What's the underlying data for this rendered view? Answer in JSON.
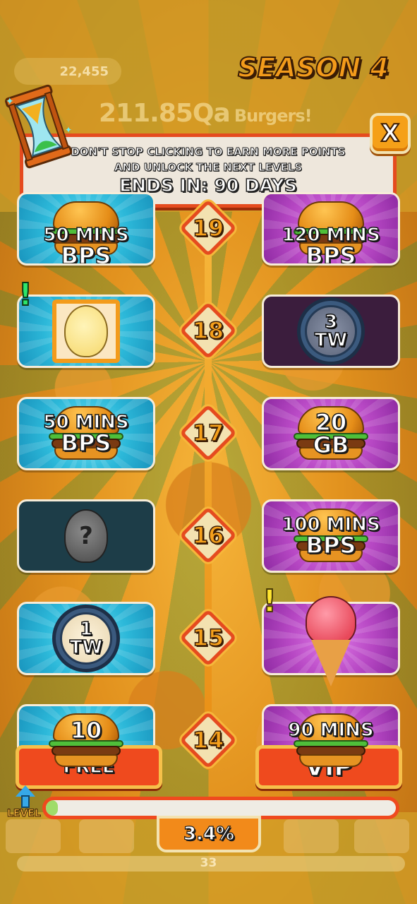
{
  "hud": {
    "score": "22,455",
    "burgers_amount": "211.85Qa",
    "burgers_unit": "Burgers!"
  },
  "season": {
    "title": "SEASON 4"
  },
  "banner": {
    "line1": "DON'T STOP CLICKING TO EARN MORE POINTS",
    "line2": "AND UNLOCK THE NEXT LEVELS",
    "ends": "ENDS IN: 90 DAYS",
    "close_label": "X"
  },
  "levels": [
    {
      "level": "19",
      "free": {
        "type": "burger",
        "line1": "50 MINS",
        "line2": "BPS"
      },
      "vip": {
        "type": "burger",
        "line1": "120 MINS",
        "line2": "BPS"
      }
    },
    {
      "level": "18",
      "free": {
        "type": "avatar-frame",
        "alert": "!"
      },
      "vip": {
        "type": "clock",
        "line1": "3",
        "line2": "TW",
        "locked": true
      }
    },
    {
      "level": "17",
      "free": {
        "type": "burger",
        "line1": "50 MINS",
        "line2": "BPS"
      },
      "vip": {
        "type": "burger",
        "line1": "20",
        "line2": "GB"
      }
    },
    {
      "level": "16",
      "free": {
        "type": "mystery",
        "symbol": "?",
        "locked": true
      },
      "vip": {
        "type": "burger",
        "line1": "100 MINS",
        "line2": "BPS"
      }
    },
    {
      "level": "15",
      "free": {
        "type": "clock",
        "line1": "1",
        "line2": "TW"
      },
      "vip": {
        "type": "icecream",
        "alert": "!"
      }
    },
    {
      "level": "14",
      "free": {
        "type": "burger",
        "line1": "10",
        "line2": ""
      },
      "vip": {
        "type": "burger",
        "line1": "90 MINS",
        "line2": ""
      }
    }
  ],
  "tabs": {
    "free_label": "FREE",
    "vip_label": "VIP"
  },
  "progress": {
    "level_label": "LEVEL",
    "percent_text": "3.4%",
    "fraction": 0.034
  },
  "footer": {
    "faded_number": "33"
  },
  "colors": {
    "free_tile": "#2cb8d9",
    "vip_tile": "#b748c4",
    "accent": "#ef4a1e",
    "gold": "#f6b73b"
  }
}
